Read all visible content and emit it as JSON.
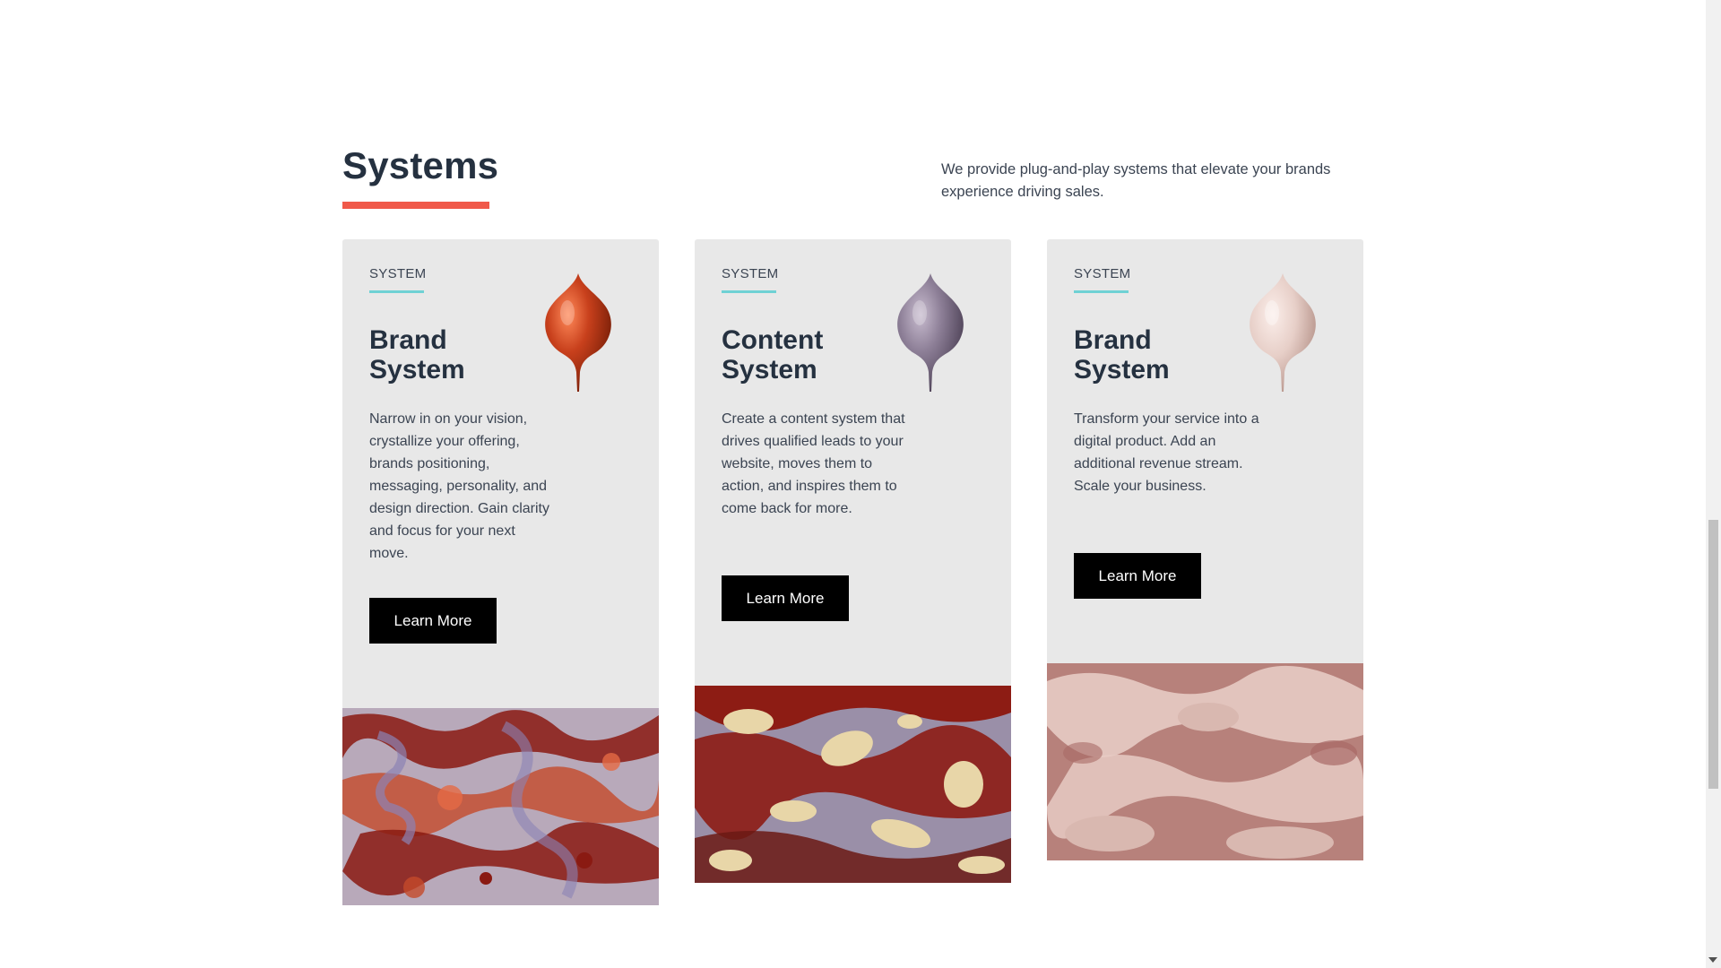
{
  "section": {
    "title": "Systems",
    "intro": "We provide plug-and-play systems that elevate your brands experience driving sales.",
    "accent_color": "#f0594a"
  },
  "cards": [
    {
      "eyebrow": "SYSTEM",
      "title": "Brand System",
      "description": "Narrow in on your vision, crystallize your offering, brands positioning, messaging, personality, and design direction. Gain clarity and focus for your next move.",
      "button_label": "Learn More",
      "drop_color": "#c8401c",
      "image_palette": [
        "#b8a9ba",
        "#8a1a12",
        "#c44a2a",
        "#8b83b5"
      ]
    },
    {
      "eyebrow": "SYSTEM",
      "title": "Content System",
      "description": "Create a content system that drives qualified leads to your website, moves them to action, and inspires them to come back for more.",
      "button_label": "Learn More",
      "drop_color": "#8d7f97",
      "image_palette": [
        "#9a8fa8",
        "#8d1c14",
        "#e8d6a8",
        "#6b3a4a"
      ]
    },
    {
      "eyebrow": "SYSTEM",
      "title": "Brand System",
      "description": "Transform your service into a digital product. Add an additional revenue stream. Scale your business.",
      "button_label": "Learn More",
      "drop_color": "#e7cfc8",
      "image_palette": [
        "#d9b8b0",
        "#b7817b",
        "#e7cbc4",
        "#a86a66"
      ]
    }
  ],
  "eyebrow_line_color": "#6fd1d4",
  "card_background": "#e8e8e8"
}
